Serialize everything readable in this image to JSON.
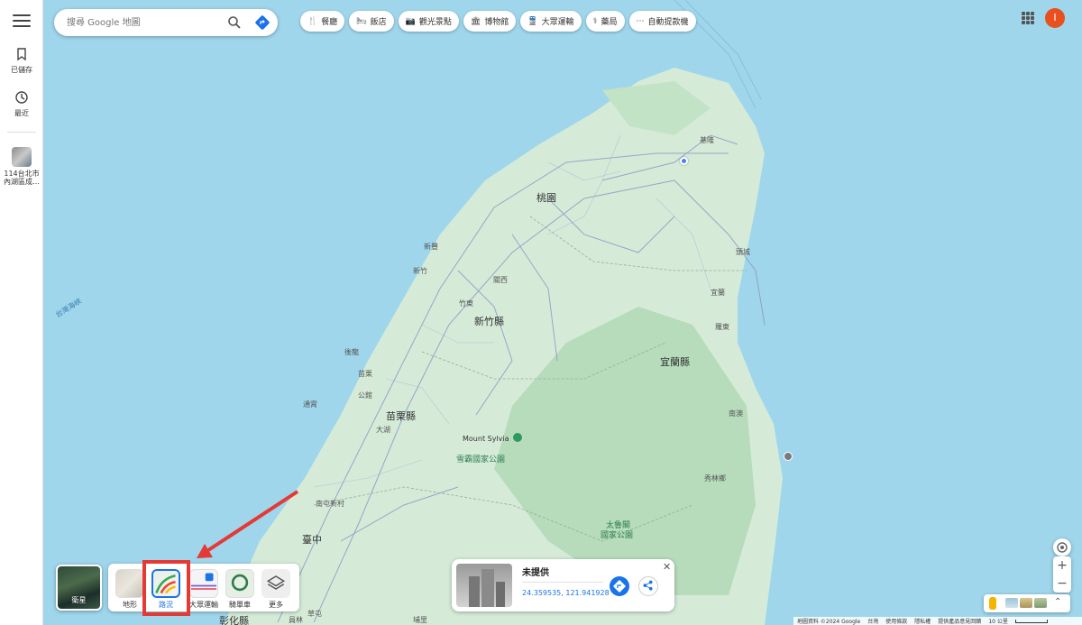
{
  "rail": {
    "saved_label": "已儲存",
    "recent_label": "最近",
    "recent_place_label": "114台北市內湖區成…"
  },
  "search": {
    "placeholder": "搜尋 Google 地圖"
  },
  "chips": [
    {
      "icon": "restaurant-icon",
      "label": "餐廳"
    },
    {
      "icon": "hotel-icon",
      "label": "飯店"
    },
    {
      "icon": "camera-icon",
      "label": "觀光景點"
    },
    {
      "icon": "museum-icon",
      "label": "博物館"
    },
    {
      "icon": "train-icon",
      "label": "大眾運輸"
    },
    {
      "icon": "pharmacy-icon",
      "label": "藥局"
    },
    {
      "icon": "atm-icon",
      "label": "自動提款機"
    }
  ],
  "account": {
    "initial": "I",
    "color": "#e8501d"
  },
  "map_labels": {
    "taoyuan": "桃園",
    "keelung": "基隆",
    "toucheng": "頭城",
    "xinfeng": "新豐",
    "hsinchu": "新竹",
    "guanxi": "關西",
    "zhudong": "竹東",
    "hsinchu_county": "新竹縣",
    "yilan": "宜蘭",
    "luodong": "羅東",
    "yilan_county": "宜蘭縣",
    "houlong": "後龍",
    "miaoli": "苗栗",
    "gongguan": "公館",
    "tongxiao": "通霄",
    "miaoli_county": "苗栗縣",
    "dahu": "大湖",
    "nanao": "南澳",
    "mount_sylvia": "Mount Sylvia",
    "shei_pa": "雪霸國家公園",
    "xiulin": "秀林鄉",
    "taroko_1": "太魯閣",
    "taroko_2": "國家公園",
    "nantun": "南屯新村",
    "taichung": "臺中",
    "changhua": "彰化縣",
    "strait": "台灣海峽",
    "puli": "埔里",
    "yuanlin": "員林",
    "caotun": "草屯"
  },
  "layers": {
    "satellite_label": "衛星",
    "items": [
      {
        "label": "地形"
      },
      {
        "label": "路況"
      },
      {
        "label": "大眾運輸"
      },
      {
        "label": "騎單車"
      },
      {
        "label": "更多"
      }
    ]
  },
  "place_card": {
    "title": "未提供",
    "coords": "24.359535, 121.941928"
  },
  "footer": {
    "items": [
      "地圖資料 ©2024 Google",
      "台灣",
      "使用條款",
      "隱私權",
      "提供產品意見回饋"
    ],
    "scale": "10 公里"
  }
}
